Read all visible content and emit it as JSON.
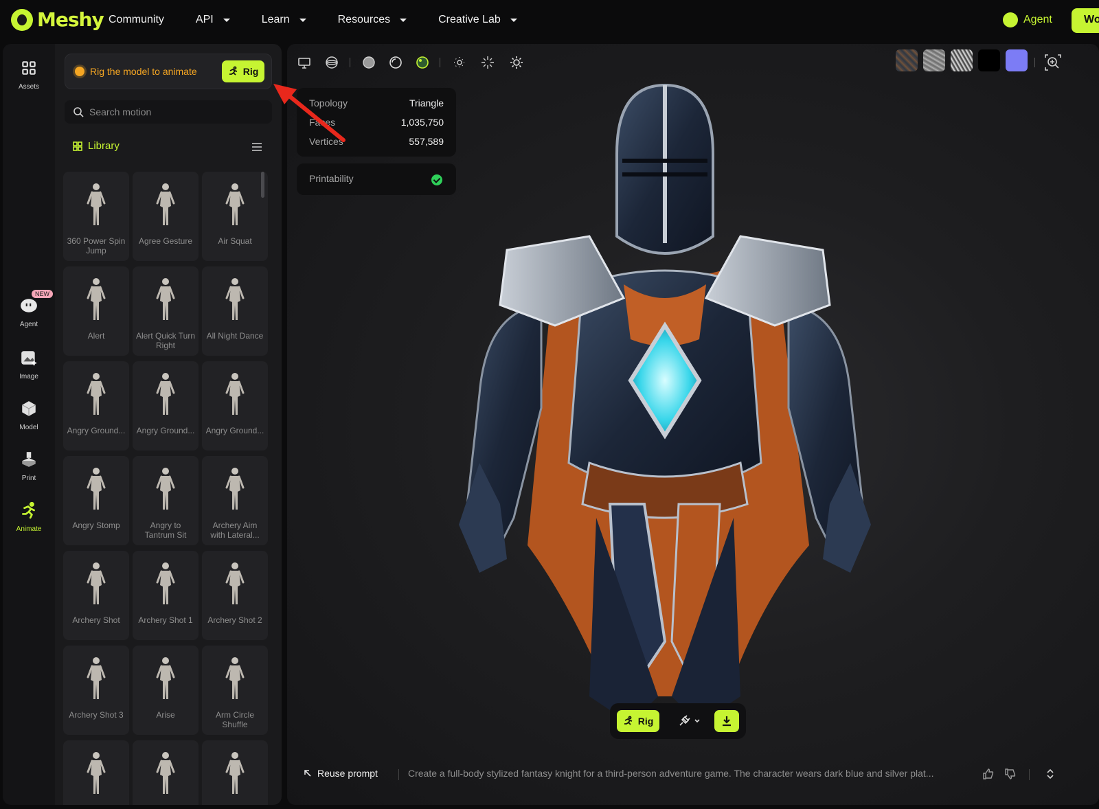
{
  "header": {
    "brand": "Meshy",
    "nav": [
      {
        "label": "Community",
        "dropdown": false
      },
      {
        "label": "API",
        "dropdown": true
      },
      {
        "label": "Learn",
        "dropdown": true
      },
      {
        "label": "Resources",
        "dropdown": true
      },
      {
        "label": "Creative Lab",
        "dropdown": true
      }
    ],
    "agent_label": "Agent",
    "workspace_btn": "Wo"
  },
  "rail": {
    "items": [
      {
        "label": "Assets",
        "icon": "grid-icon"
      },
      {
        "label": "Agent",
        "icon": "agent-icon",
        "badge": "NEW"
      },
      {
        "label": "Image",
        "icon": "image-icon"
      },
      {
        "label": "Model",
        "icon": "cube-icon"
      },
      {
        "label": "Print",
        "icon": "printer-icon"
      },
      {
        "label": "Animate",
        "icon": "running-figure-icon",
        "active": true
      }
    ]
  },
  "panel": {
    "banner_text": "Rig the model to animate",
    "rig_label": "Rig",
    "search_placeholder": "Search motion",
    "library_label": "Library",
    "motions": [
      "360 Power Spin Jump",
      "Agree Gesture",
      "Air Squat",
      "Alert",
      "Alert Quick Turn Right",
      "All Night Dance",
      "Angry Ground...",
      "Angry Ground...",
      "Angry Ground...",
      "Angry Stomp",
      "Angry to Tantrum Sit",
      "Archery Aim with Lateral...",
      "Archery Shot",
      "Archery Shot 1",
      "Archery Shot 2",
      "Archery Shot 3",
      "Arise",
      "Arm Circle Shuffle",
      "",
      "",
      ""
    ]
  },
  "viewport": {
    "stats": {
      "topology_label": "Topology",
      "topology_value": "Triangle",
      "faces_label": "Faces",
      "faces_value": "1,035,750",
      "vertices_label": "Vertices",
      "vertices_value": "557,589"
    },
    "printability_label": "Printability",
    "printability_ok": true,
    "swatch_colors": [
      "#5a4a42",
      "#9a9a9a",
      "#d8d8d8",
      "#000000",
      "#7c7cf5"
    ],
    "bottom_rig_label": "Rig",
    "reuse_label": "Reuse prompt",
    "prompt_text": "Create a full-body stylized fantasy knight for a third-person adventure game. The character wears dark blue and silver plat..."
  },
  "colors": {
    "accent": "#c6f432",
    "warning": "#f5a623",
    "arrow": "#e8281c"
  }
}
